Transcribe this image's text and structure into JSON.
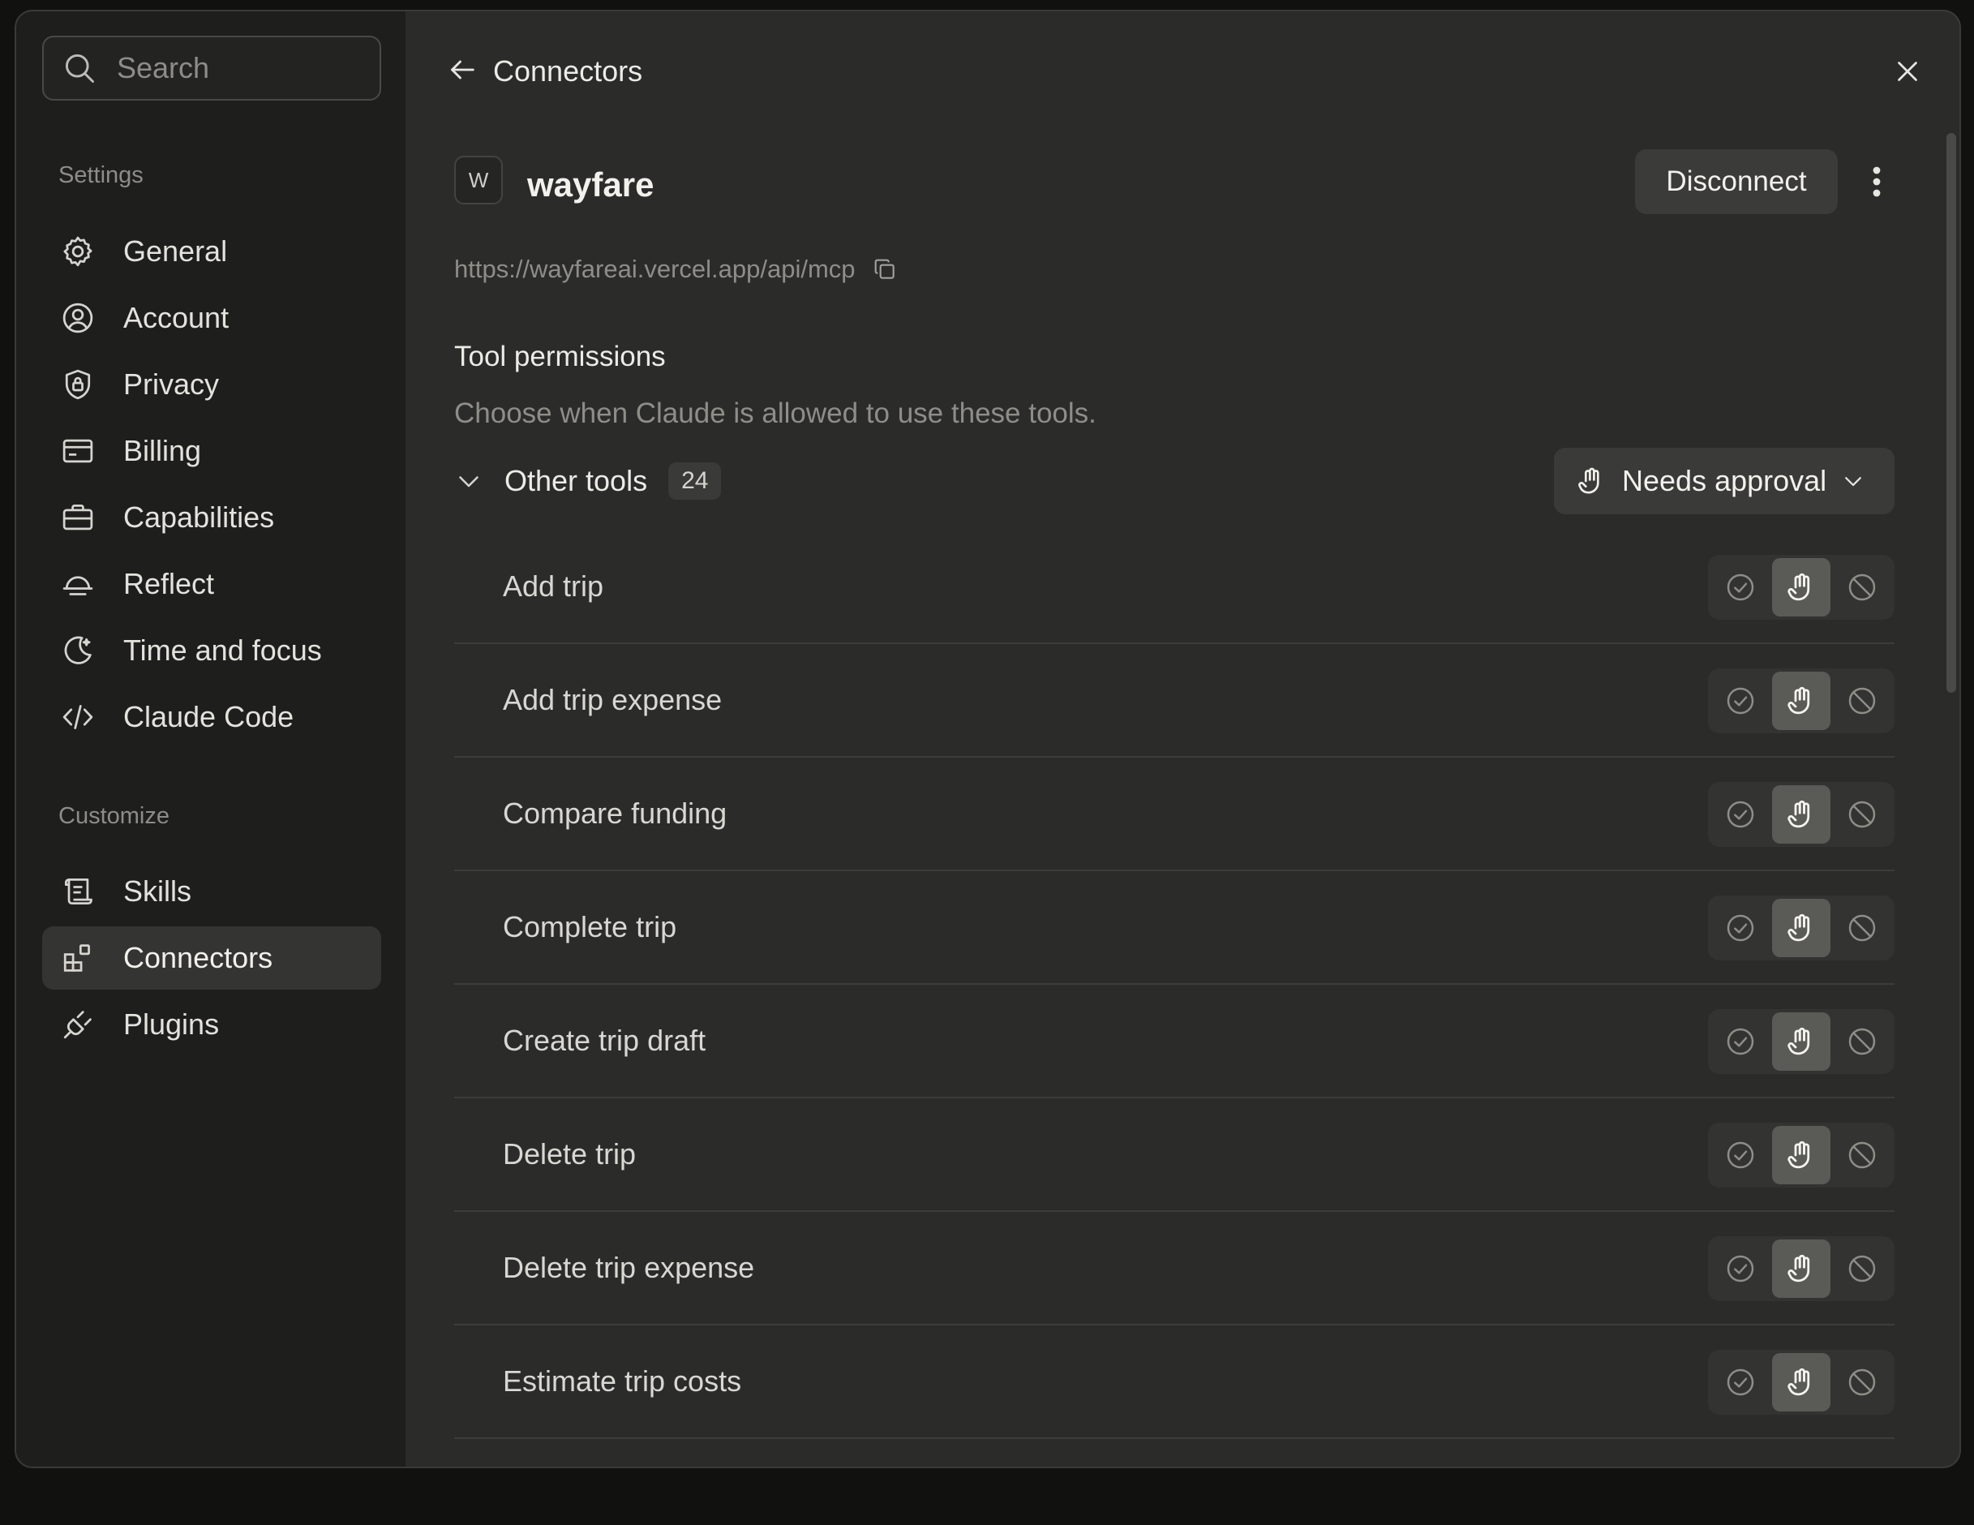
{
  "search": {
    "placeholder": "Search"
  },
  "sidebar": {
    "settings_label": "Settings",
    "settings_items": [
      {
        "label": "General",
        "icon": "gear-icon"
      },
      {
        "label": "Account",
        "icon": "user-circle-icon"
      },
      {
        "label": "Privacy",
        "icon": "shield-lock-icon"
      },
      {
        "label": "Billing",
        "icon": "credit-card-icon"
      },
      {
        "label": "Capabilities",
        "icon": "toolbox-icon"
      },
      {
        "label": "Reflect",
        "icon": "sunset-icon"
      },
      {
        "label": "Time and focus",
        "icon": "moon-icon"
      },
      {
        "label": "Claude Code",
        "icon": "code-icon"
      }
    ],
    "customize_label": "Customize",
    "customize_items": [
      {
        "label": "Skills",
        "icon": "scroll-icon"
      },
      {
        "label": "Connectors",
        "icon": "connectors-icon",
        "active": true
      },
      {
        "label": "Plugins",
        "icon": "plug-icon"
      }
    ]
  },
  "header": {
    "title": "Connectors"
  },
  "connector": {
    "logo_letter": "W",
    "name": "wayfare",
    "url": "https://wayfareai.vercel.app/api/mcp",
    "disconnect_label": "Disconnect"
  },
  "permissions": {
    "title": "Tool permissions",
    "description": "Choose when Claude is allowed to use these tools.",
    "group": {
      "label": "Other tools",
      "count": "24",
      "selected": "Needs approval"
    },
    "tools": [
      {
        "name": "Add trip",
        "mode": "needs-approval"
      },
      {
        "name": "Add trip expense",
        "mode": "needs-approval"
      },
      {
        "name": "Compare funding",
        "mode": "needs-approval"
      },
      {
        "name": "Complete trip",
        "mode": "needs-approval"
      },
      {
        "name": "Create trip draft",
        "mode": "needs-approval"
      },
      {
        "name": "Delete trip",
        "mode": "needs-approval"
      },
      {
        "name": "Delete trip expense",
        "mode": "needs-approval"
      },
      {
        "name": "Estimate trip costs",
        "mode": "needs-approval"
      }
    ]
  },
  "colors": {
    "background": "#2b2b2a",
    "sidebar": "#1e1e1d",
    "selected_segment": "#5a5a57"
  }
}
